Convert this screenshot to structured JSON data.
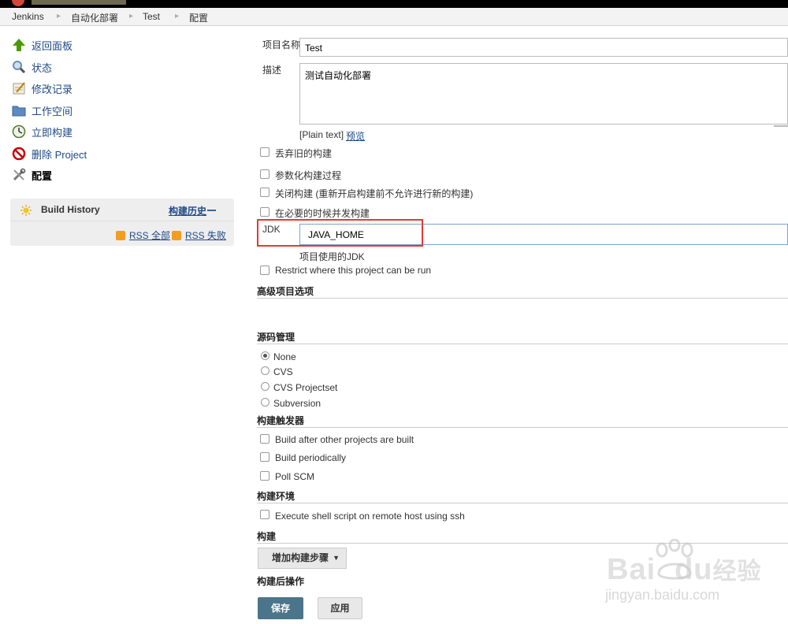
{
  "breadcrumbs": [
    "Jenkins",
    "自动化部署",
    "Test",
    "配置"
  ],
  "sidebar": {
    "items": [
      {
        "label": "返回面板",
        "icon": "up-arrow-icon"
      },
      {
        "label": "状态",
        "icon": "magnifier-icon"
      },
      {
        "label": "修改记录",
        "icon": "notepad-icon"
      },
      {
        "label": "工作空间",
        "icon": "folder-icon"
      },
      {
        "label": "立即构建",
        "icon": "clock-build-icon"
      },
      {
        "label": "删除 Project",
        "icon": "no-entry-icon"
      },
      {
        "label": "配置",
        "icon": "tools-icon"
      }
    ],
    "build_history": {
      "title": "Build History",
      "trend_link": "构建历史",
      "rss_all": "RSS 全部",
      "rss_failed": "RSS 失败"
    }
  },
  "form": {
    "project_name_label": "项目名称",
    "project_name_value": "Test",
    "description_label": "描述",
    "description_value": "测试自动化部署",
    "plain_text": "[Plain text]",
    "preview": "预览",
    "options": {
      "discard_old": "丢弃旧的构建",
      "parameterized": "参数化构建过程",
      "disable_build": "关闭构建 (重新开启构建前不允许进行新的构建)",
      "concurrent": "在必要的时候并发构建"
    },
    "jdk_label": "JDK",
    "jdk_value": "JAVA_HOME",
    "jdk_help": "项目使用的JDK",
    "restrict": "Restrict where this project can be run"
  },
  "sections": {
    "advanced": "高级项目选项",
    "scm": "源码管理",
    "triggers": "构建触发器",
    "env": "构建环境",
    "build": "构建",
    "post": "构建后操作"
  },
  "scm_options": [
    "None",
    "CVS",
    "CVS Projectset",
    "Subversion"
  ],
  "triggers": [
    "Build after other projects are built",
    "Build periodically",
    "Poll SCM"
  ],
  "env_options": [
    "Execute shell script on remote host using ssh"
  ],
  "buttons": {
    "add_step": "增加构建步骤",
    "save": "保存",
    "apply": "应用"
  },
  "watermark": {
    "brand": "Bai",
    "brand2": "du",
    "brand3": "经验",
    "url": "jingyan.baidu.com"
  },
  "colors": {
    "highlight_box": "#e53935",
    "save_button": "#4b758b",
    "link": "#204a87"
  }
}
